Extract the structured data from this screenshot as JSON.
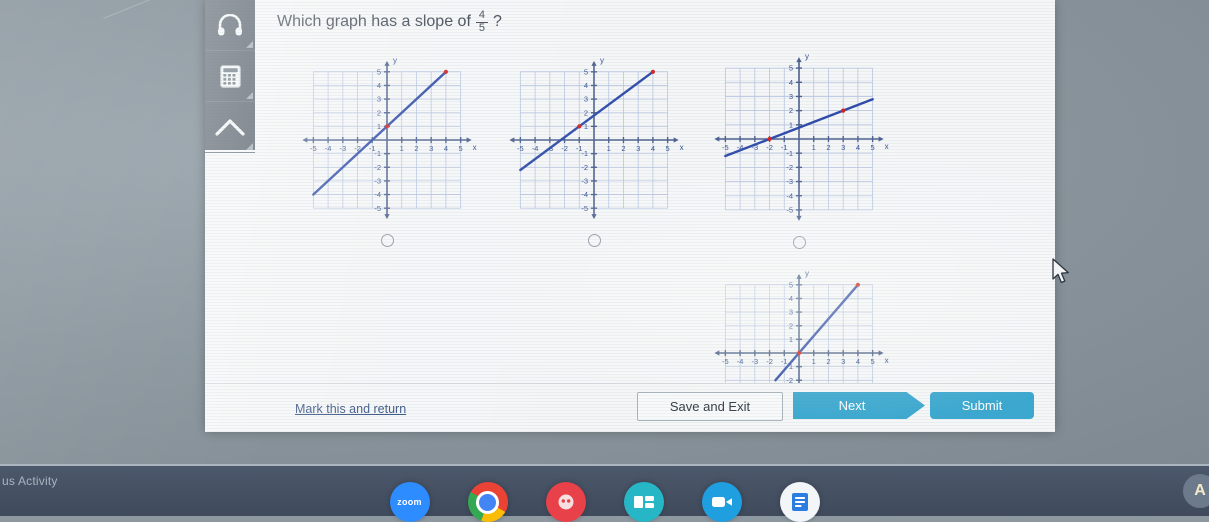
{
  "question": {
    "prefix": "Which graph has a slope of",
    "fraction_numerator": "4",
    "fraction_denominator": "5",
    "suffix": "?"
  },
  "toolbar": {
    "items": [
      {
        "name": "headphones-icon",
        "label": "Text to speech"
      },
      {
        "name": "calculator-icon",
        "label": "Calculator"
      },
      {
        "name": "up-arrow-icon",
        "label": "Scroll up"
      }
    ]
  },
  "footer": {
    "mark_link": "Mark this and return",
    "save_label": "Save and Exit",
    "next_label": "Next",
    "submit_label": "Submit"
  },
  "taskbar": {
    "activity_text": "us Activity",
    "avatar_initial": "A",
    "apps": [
      {
        "name": "zoom-app-icon",
        "label": "zoom"
      },
      {
        "name": "chrome-app-icon",
        "label": ""
      },
      {
        "name": "red-app-icon",
        "label": ""
      },
      {
        "name": "teal-app-icon",
        "label": ""
      },
      {
        "name": "video-app-icon",
        "label": ""
      },
      {
        "name": "document-app-icon",
        "label": ""
      }
    ]
  },
  "colors": {
    "line": "#2c49a8",
    "point": "#d32020",
    "grid": "#b9c6e2",
    "axis": "#4a5f8c",
    "accent": "#3aa8d0",
    "rail": "#4a5560",
    "link": "#2b4a7e"
  },
  "axis_ticks": {
    "x": [
      "-5",
      "-4",
      "-3",
      "-2",
      "-1",
      "1",
      "2",
      "3",
      "4",
      "5"
    ],
    "y": [
      "5",
      "4",
      "3",
      "2",
      "1",
      "-1",
      "-2",
      "-3",
      "-4",
      "-5"
    ],
    "x_label": "x",
    "y_label": "y"
  },
  "chart_data": [
    {
      "id": "choice-a",
      "type": "line",
      "title": "",
      "xlabel": "x",
      "ylabel": "y",
      "xlim": [
        -5,
        5
      ],
      "ylim": [
        -5,
        5
      ],
      "grid": true,
      "slope": 1,
      "intercept": 1,
      "points": [
        [
          0,
          1
        ],
        [
          4,
          5
        ]
      ],
      "line_endpoints": [
        [
          -5,
          -4
        ],
        [
          4,
          5
        ]
      ],
      "selected": false
    },
    {
      "id": "choice-b",
      "type": "line",
      "title": "",
      "xlabel": "x",
      "ylabel": "y",
      "xlim": [
        -5,
        5
      ],
      "ylim": [
        -5,
        5
      ],
      "grid": true,
      "slope": 0.8,
      "intercept": 1.8,
      "points": [
        [
          -1,
          1
        ],
        [
          4,
          5
        ]
      ],
      "line_endpoints": [
        [
          -5,
          -2.2
        ],
        [
          4,
          5
        ]
      ],
      "selected": false
    },
    {
      "id": "choice-c",
      "type": "line",
      "title": "",
      "xlabel": "x",
      "ylabel": "y",
      "xlim": [
        -5,
        5
      ],
      "ylim": [
        -5,
        5
      ],
      "grid": true,
      "slope": 0.4,
      "intercept": 0.8,
      "points": [
        [
          -2,
          0
        ],
        [
          3,
          2
        ]
      ],
      "line_endpoints": [
        [
          -5,
          -1.2
        ],
        [
          5,
          2.8
        ]
      ],
      "selected": false
    },
    {
      "id": "choice-d",
      "type": "line",
      "title": "",
      "xlabel": "x",
      "ylabel": "y",
      "xlim": [
        -5,
        5
      ],
      "ylim": [
        -5,
        5
      ],
      "grid": true,
      "slope": 1.25,
      "intercept": 0,
      "points": [
        [
          0,
          0
        ],
        [
          4,
          5
        ]
      ],
      "line_endpoints": [
        [
          -1.6,
          -2
        ],
        [
          4,
          5
        ]
      ],
      "selected": false
    }
  ]
}
